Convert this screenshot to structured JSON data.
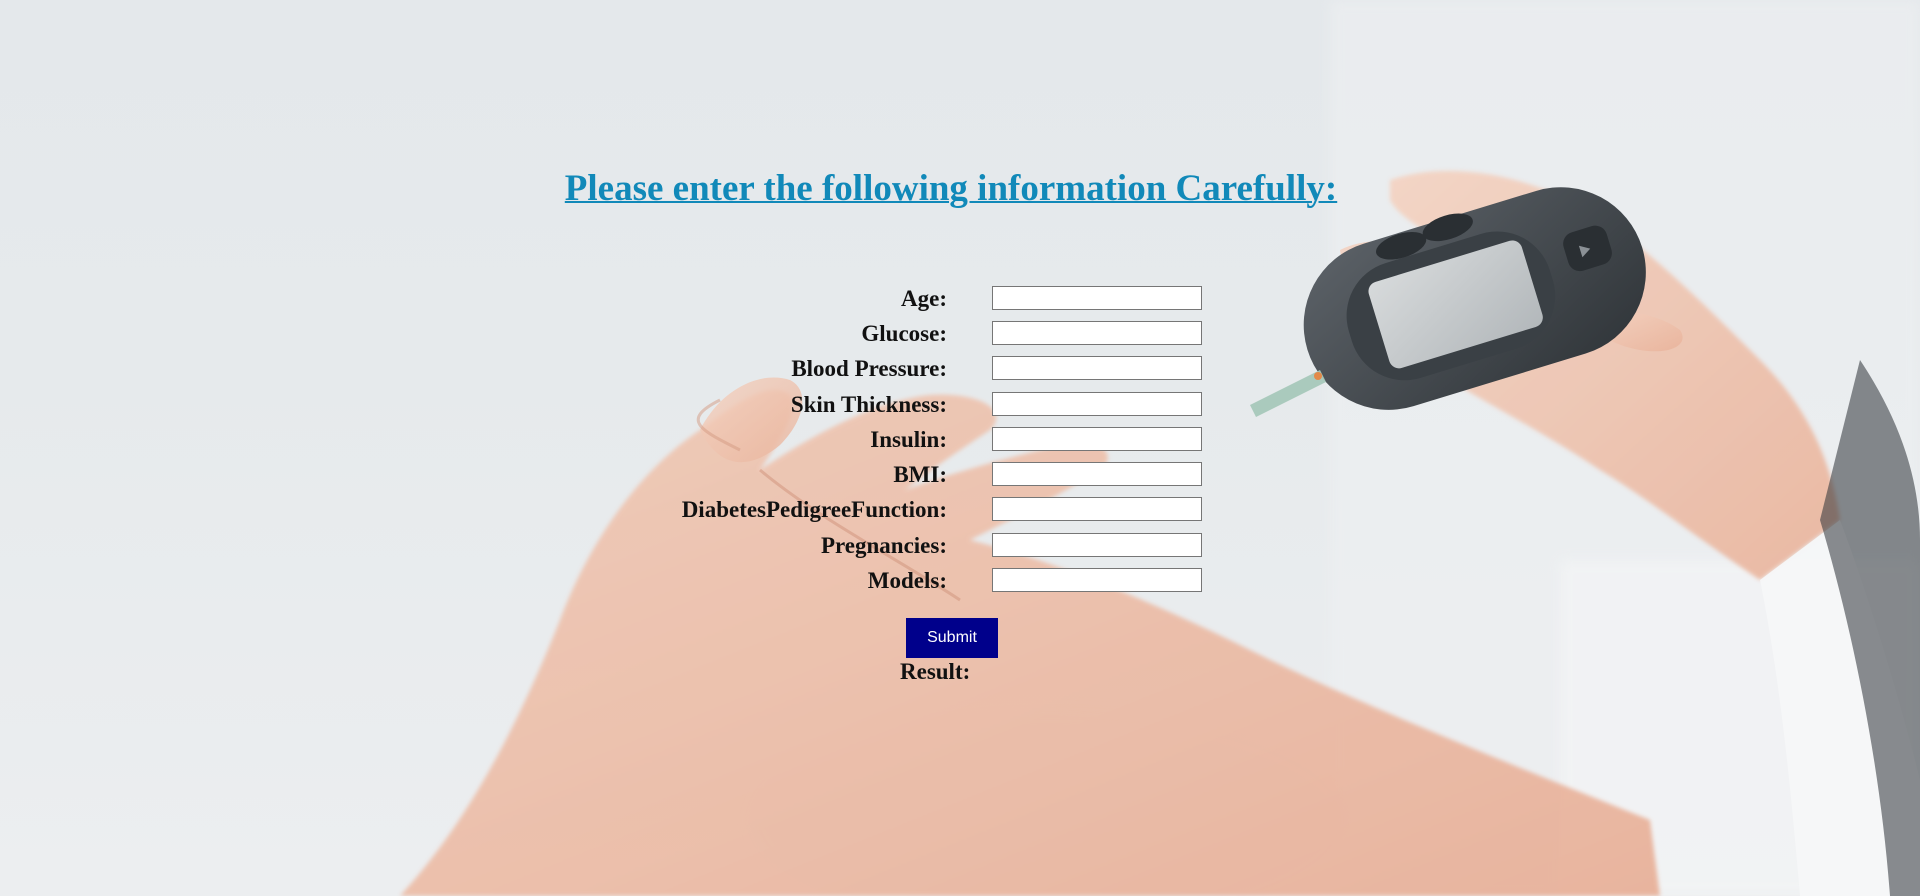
{
  "form": {
    "heading": "Please enter the following information Carefully:",
    "fields": [
      {
        "label": "Age:",
        "value": ""
      },
      {
        "label": "Glucose:",
        "value": ""
      },
      {
        "label": "Blood Pressure:",
        "value": ""
      },
      {
        "label": "Skin Thickness:",
        "value": ""
      },
      {
        "label": "Insulin:",
        "value": ""
      },
      {
        "label": "BMI:",
        "value": ""
      },
      {
        "label": "DiabetesPedigreeFunction:",
        "value": ""
      },
      {
        "label": "Pregnancies:",
        "value": ""
      },
      {
        "label": "Models:",
        "value": ""
      }
    ],
    "submit_label": "Submit",
    "result_label": "Result:"
  },
  "colors": {
    "heading": "#1189b9",
    "button_bg": "#00008b",
    "button_text": "#ffffff"
  }
}
